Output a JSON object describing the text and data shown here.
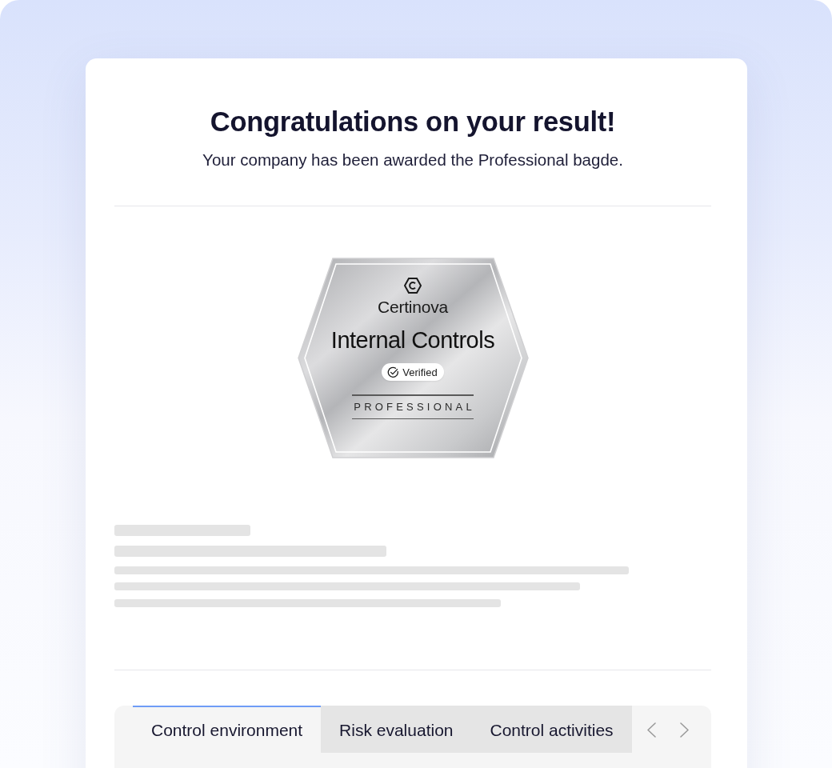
{
  "heading": {
    "title": "Congratulations on your result!",
    "subtitle": "Your company has been awarded the Professional bagde."
  },
  "badge": {
    "brand": "Certinova",
    "name": "Internal Controls",
    "status": "Verified",
    "tier": "PROFESSIONAL"
  },
  "tabs": [
    {
      "label": "Control environment",
      "selected": true
    },
    {
      "label": "Risk evaluation",
      "selected": false
    },
    {
      "label": "Control activities",
      "selected": false
    }
  ]
}
